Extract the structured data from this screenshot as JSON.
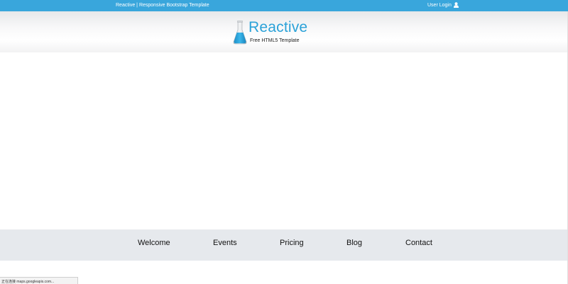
{
  "topbar": {
    "site_text": "Reactive | Responsive Bootstrap Template",
    "login_label": "User Login",
    "login_icon": "user-icon",
    "bg_color": "#39a6dc"
  },
  "header": {
    "brand": "Reactive",
    "tagline": "Free HTML5 Template",
    "logo_icon": "flask-icon",
    "brand_color": "#2ba2d8"
  },
  "nav": {
    "items": [
      {
        "label": "Welcome"
      },
      {
        "label": "Events"
      },
      {
        "label": "Pricing"
      },
      {
        "label": "Blog"
      },
      {
        "label": "Contact"
      }
    ],
    "bg_color": "#e6e9ed"
  },
  "status_bar": {
    "text": "正在连接 maps.googleapis.com..."
  }
}
